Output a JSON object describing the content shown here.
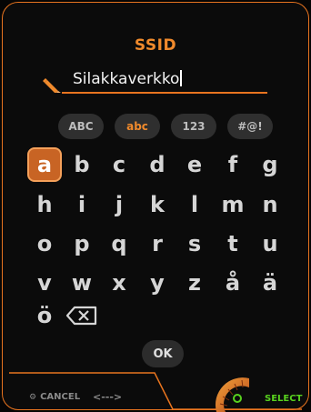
{
  "dialog": {
    "title": "SSID"
  },
  "input": {
    "value": "Silakkaverkko"
  },
  "modes": [
    {
      "label": "ABC",
      "active": false
    },
    {
      "label": "abc",
      "active": true
    },
    {
      "label": "123",
      "active": false
    },
    {
      "label": "#@!",
      "active": false
    }
  ],
  "keys": {
    "row1": [
      "a",
      "b",
      "c",
      "d",
      "e",
      "f",
      "g"
    ],
    "row2": [
      "h",
      "i",
      "j",
      "k",
      "l",
      "m",
      "n"
    ],
    "row3": [
      "o",
      "p",
      "q",
      "r",
      "s",
      "t",
      "u"
    ],
    "row4": [
      "v",
      "w",
      "x",
      "y",
      "z",
      "å",
      "ä"
    ],
    "row5": [
      "ö"
    ],
    "selected": "a"
  },
  "actions": {
    "ok_label": "OK",
    "cancel_label": "CANCEL",
    "nav_hint": "<--->",
    "select_label": "SELECT"
  },
  "colors": {
    "accent": "#e8741f",
    "accent_text": "#f08a2c",
    "select_green": "#58d21e"
  },
  "icons": [
    "pencil-icon",
    "backspace-icon",
    "gear-icon",
    "rotary-knob-icon"
  ]
}
